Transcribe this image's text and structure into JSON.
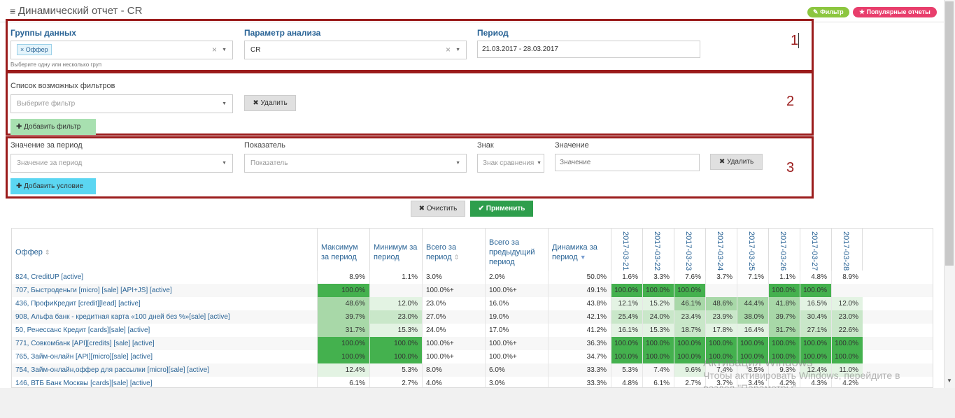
{
  "header": {
    "menu_icon": "≡",
    "title": "Динамический отчет - CR",
    "filter_button": "Фильтр",
    "popular_button": "Популярные отчеты"
  },
  "section1": {
    "number": "1",
    "groups_label": "Группы данных",
    "groups_tag": "Оффер",
    "groups_hint": "Выберите одну или несколько груп",
    "param_label": "Параметр анализа",
    "param_value": "CR",
    "period_label": "Период",
    "period_value": "21.03.2017 - 28.03.2017"
  },
  "section2": {
    "number": "2",
    "filters_label": "Список возможных фильтров",
    "filter_placeholder": "Выберите фильтр",
    "delete_label": "Удалить",
    "add_label": "Добавить фильтр"
  },
  "section3": {
    "number": "3",
    "period_value_label": "Значение за период",
    "period_value_placeholder": "Значение за период",
    "indicator_label": "Показатель",
    "indicator_placeholder": "Показатель",
    "sign_label": "Знак",
    "sign_placeholder": "Знак сравнения",
    "value_label": "Значение",
    "value_placeholder": "Значение",
    "delete_label": "Удалить",
    "add_label": "Добавить условие"
  },
  "actions": {
    "clear_label": "Очистить",
    "apply_label": "Применить"
  },
  "colors": {
    "accent_green": "#2e9e4c",
    "filter_green": "#8cc63f",
    "popular_pink": "#e83e6c",
    "frame_red": "#9b1c1c",
    "link_blue": "#2a6496",
    "heat_max": "#44b14e",
    "heat_high": "#a8d8a8",
    "heat_mid": "#c9e7c9",
    "heat_low": "#e3f3e3"
  },
  "table": {
    "columns": {
      "offer": "Оффер",
      "max": "Максимум за период",
      "min": "Минимум за период",
      "total": "Всего за период",
      "prev": "Всего за предыдущий период",
      "dyn": "Динамика за период"
    },
    "dates": [
      "2017-03-21",
      "2017-03-22",
      "2017-03-23",
      "2017-03-24",
      "2017-03-25",
      "2017-03-26",
      "2017-03-27",
      "2017-03-28"
    ],
    "rows": [
      {
        "name": "824, CreditUP [active]",
        "max": "8.9%",
        "min": "1.1%",
        "total": "3.0%",
        "prev": "2.0%",
        "dyn": "50.0%",
        "days": [
          "1.6%",
          "3.3%",
          "7.6%",
          "3.7%",
          "7.1%",
          "1.1%",
          "4.8%",
          "8.9%"
        ],
        "lvl": {
          "max": 0,
          "min": 0,
          "days": [
            0,
            0,
            0,
            0,
            0,
            0,
            0,
            0
          ]
        }
      },
      {
        "name": "707, Быстроденьги [micro] [sale] [API+JS] [active]",
        "max": "100.0%",
        "min": "",
        "total": "100.0%+",
        "prev": "100.0%+",
        "dyn": "49.1%",
        "days": [
          "100.0%",
          "100.0%",
          "100.0%",
          "",
          "",
          "100.0%",
          "100.0%",
          ""
        ],
        "lvl": {
          "max": 4,
          "min": 0,
          "days": [
            4,
            4,
            4,
            0,
            0,
            4,
            4,
            0
          ]
        }
      },
      {
        "name": "436, ПрофиКредит [credit][lead] [active]",
        "max": "48.6%",
        "min": "12.0%",
        "total": "23.0%",
        "prev": "16.0%",
        "dyn": "43.8%",
        "days": [
          "12.1%",
          "15.2%",
          "46.1%",
          "48.6%",
          "44.4%",
          "41.8%",
          "16.5%",
          "12.0%"
        ],
        "lvl": {
          "max": 3,
          "min": 1,
          "days": [
            1,
            1,
            3,
            3,
            3,
            3,
            1,
            1
          ]
        }
      },
      {
        "name": "908, Альфа банк - кредитная карта «100 дней без %»[sale] [active]",
        "max": "39.7%",
        "min": "23.0%",
        "total": "27.0%",
        "prev": "19.0%",
        "dyn": "42.1%",
        "days": [
          "25.4%",
          "24.0%",
          "23.4%",
          "23.9%",
          "38.0%",
          "39.7%",
          "30.4%",
          "23.0%"
        ],
        "lvl": {
          "max": 3,
          "min": 2,
          "days": [
            2,
            2,
            2,
            2,
            3,
            3,
            2,
            2
          ]
        }
      },
      {
        "name": "50, Ренессанс Кредит [cards][sale] [active]",
        "max": "31.7%",
        "min": "15.3%",
        "total": "24.0%",
        "prev": "17.0%",
        "dyn": "41.2%",
        "days": [
          "16.1%",
          "15.3%",
          "18.7%",
          "17.8%",
          "16.4%",
          "31.7%",
          "27.1%",
          "22.6%"
        ],
        "lvl": {
          "max": 3,
          "min": 1,
          "days": [
            1,
            1,
            2,
            1,
            1,
            3,
            2,
            2
          ]
        }
      },
      {
        "name": "771, Совкомбанк [API][credits] [sale] [active]",
        "max": "100.0%",
        "min": "100.0%",
        "total": "100.0%+",
        "prev": "100.0%+",
        "dyn": "36.3%",
        "days": [
          "100.0%",
          "100.0%",
          "100.0%",
          "100.0%",
          "100.0%",
          "100.0%",
          "100.0%",
          "100.0%"
        ],
        "lvl": {
          "max": 4,
          "min": 4,
          "days": [
            4,
            4,
            4,
            4,
            4,
            4,
            4,
            4
          ]
        }
      },
      {
        "name": "765, Займ-онлайн [API][micro][sale] [active]",
        "max": "100.0%",
        "min": "100.0%",
        "total": "100.0%+",
        "prev": "100.0%+",
        "dyn": "34.7%",
        "days": [
          "100.0%",
          "100.0%",
          "100.0%",
          "100.0%",
          "100.0%",
          "100.0%",
          "100.0%",
          "100.0%"
        ],
        "lvl": {
          "max": 4,
          "min": 4,
          "days": [
            4,
            4,
            4,
            4,
            4,
            4,
            4,
            4
          ]
        }
      },
      {
        "name": "754, Займ-онлайн,оффер для рассылки [micro][sale] [active]",
        "max": "12.4%",
        "min": "5.3%",
        "total": "8.0%",
        "prev": "6.0%",
        "dyn": "33.3%",
        "days": [
          "5.3%",
          "7.4%",
          "9.6%",
          "7.4%",
          "8.5%",
          "9.3%",
          "12.4%",
          "11.0%"
        ],
        "lvl": {
          "max": 1,
          "min": 0,
          "days": [
            0,
            0,
            1,
            0,
            0,
            0,
            1,
            1
          ]
        }
      },
      {
        "name": "146, ВТБ Банк Москвы [cards][sale] [active]",
        "max": "6.1%",
        "min": "2.7%",
        "total": "4.0%",
        "prev": "3.0%",
        "dyn": "33.3%",
        "days": [
          "4.8%",
          "6.1%",
          "2.7%",
          "3.7%",
          "3.4%",
          "4.2%",
          "4.3%",
          "4.2%"
        ],
        "lvl": {
          "max": 0,
          "min": 0,
          "days": [
            0,
            0,
            0,
            0,
            0,
            0,
            0,
            0
          ]
        }
      }
    ]
  },
  "watermark": {
    "line1": "Активация Windows",
    "line2": "Чтобы активировать Windows, перейдите в",
    "line3": "раздел \"Параметры\"."
  }
}
